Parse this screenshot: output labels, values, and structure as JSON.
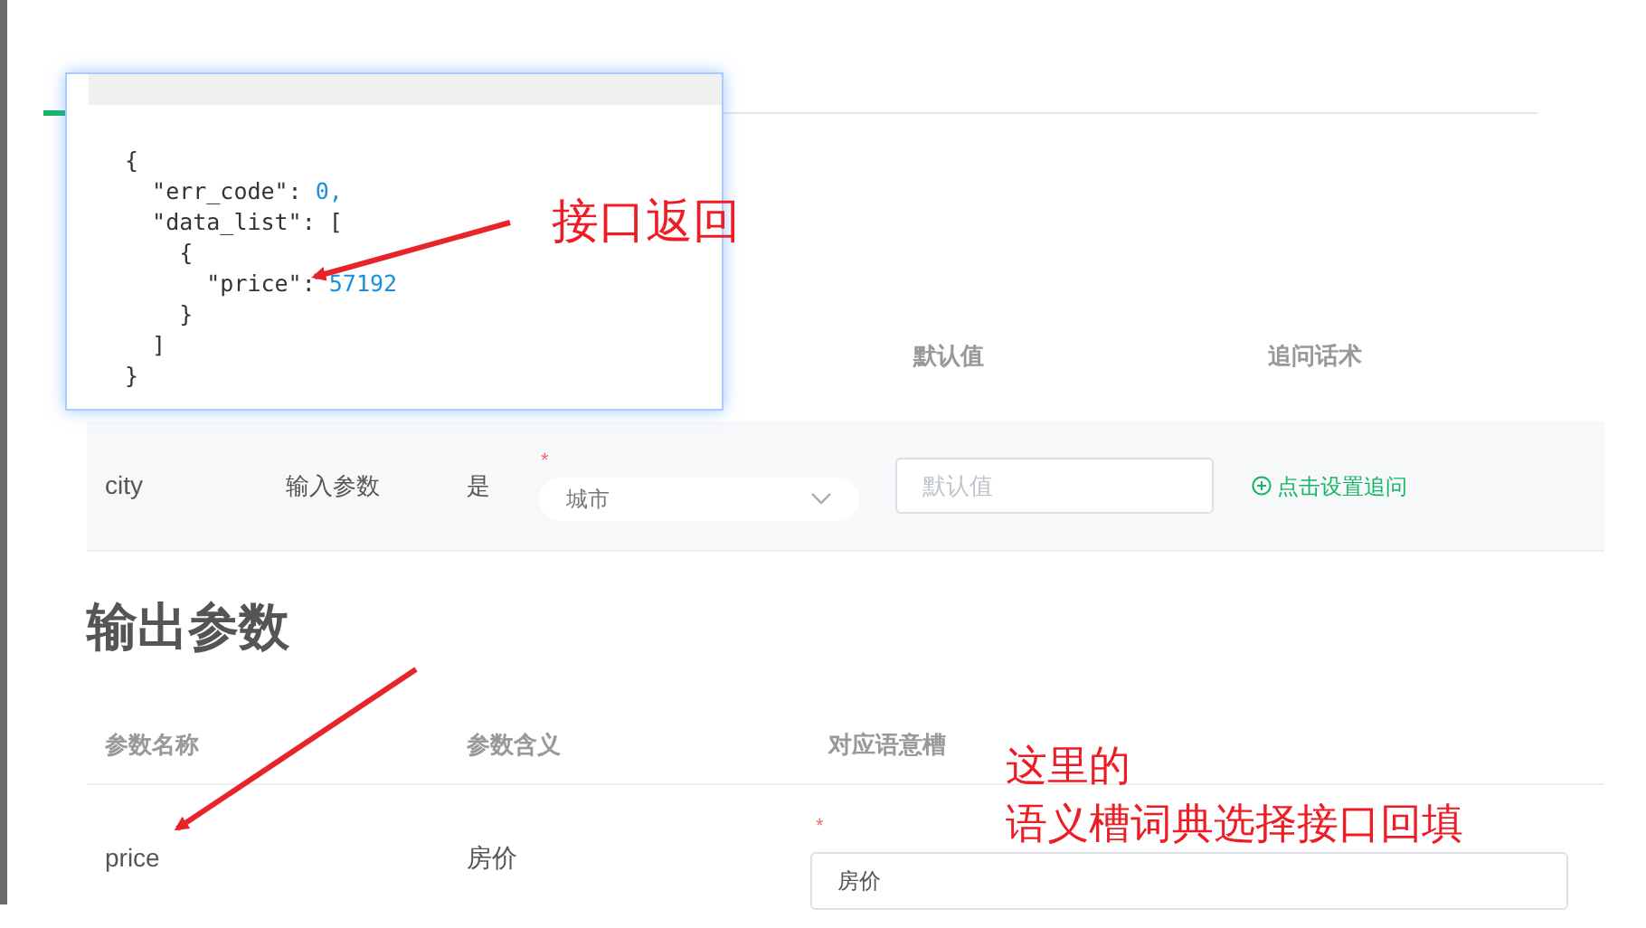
{
  "popup": {
    "code_lines": [
      {
        "text": "{"
      },
      {
        "text": "  \"err_code\": ",
        "value": "0,"
      },
      {
        "text": "  \"data_list\": ["
      },
      {
        "text": "    {"
      },
      {
        "text": "      \"price\": ",
        "value": "57192"
      },
      {
        "text": "    }"
      },
      {
        "text": "  ]"
      },
      {
        "text": "}"
      }
    ]
  },
  "input_table": {
    "columns": [
      "默认值",
      "追问话术"
    ],
    "rows": [
      {
        "name": "city",
        "kind_label": "输入参数",
        "required": "是",
        "required_mark": "*",
        "slot": "城市",
        "default_placeholder": "默认值",
        "action": "点击设置追问"
      }
    ]
  },
  "output_section": {
    "title": "输出参数",
    "columns": [
      "参数名称",
      "参数含义",
      "对应语意槽"
    ],
    "rows": [
      {
        "name": "price",
        "meaning": "房价",
        "required_mark": "*",
        "slot": "房价"
      }
    ]
  },
  "annotations": [
    {
      "text": "接口返回"
    },
    {
      "text": "这里的"
    },
    {
      "text": "语义槽词典选择接口回填"
    }
  ]
}
